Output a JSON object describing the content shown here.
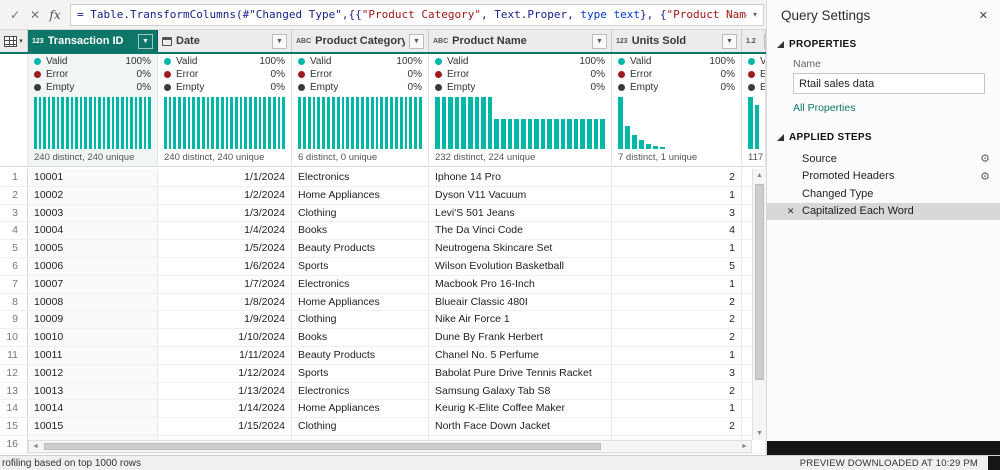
{
  "colors": {
    "accent_teal": "#0E7569",
    "histogram_teal": "#00B7A8",
    "valid_dot": "#00B7A8",
    "error_dot": "#9B1C1C",
    "empty_dot": "#3B3A39"
  },
  "icons": {
    "commit": "✓",
    "cancel": "✕",
    "fx": "fx",
    "chevron": "▾",
    "close": "✕",
    "delete": "✕",
    "gear": "⚙",
    "filter": "▼",
    "up": "▲",
    "down": "▼",
    "left": "◄",
    "right": "►",
    "corner_arrow": "▾",
    "type_whole": "123",
    "type_decimal": "1.2",
    "type_text": "ABC"
  },
  "formula_bar": {
    "segments": [
      {
        "text": "= Table.TransformColumns(#\"Changed Type\",{{",
        "color": "navy"
      },
      {
        "text": "\"Product Category\"",
        "color": "red"
      },
      {
        "text": ", Text.Proper, ",
        "color": "navy"
      },
      {
        "text": "type text",
        "color": "blue"
      },
      {
        "text": "}, {",
        "color": "navy"
      },
      {
        "text": "\"Product Name\",",
        "color": "red"
      }
    ]
  },
  "grid": {
    "quality_labels": {
      "valid": "Valid",
      "error": "Error",
      "empty": "Empty"
    },
    "columns": [
      {
        "name": "Transaction ID",
        "type": "whole-number",
        "selected": true,
        "quality": {
          "valid": "100%",
          "error": "0%",
          "empty": "0%"
        },
        "distinct": "240 distinct, 240 unique",
        "histogram": {
          "fill": true,
          "heights": [
            1,
            1,
            1,
            1,
            1,
            1,
            1,
            1,
            1,
            1,
            1,
            1,
            1,
            1,
            1,
            1,
            1,
            1,
            1,
            1,
            1,
            1,
            1,
            1,
            1,
            1
          ]
        }
      },
      {
        "name": "Date",
        "type": "date",
        "selected": false,
        "quality": {
          "valid": "100%",
          "error": "0%",
          "empty": "0%"
        },
        "distinct": "240 distinct, 240 unique",
        "histogram": {
          "fill": true,
          "heights": [
            1,
            1,
            1,
            1,
            1,
            1,
            1,
            1,
            1,
            1,
            1,
            1,
            1,
            1,
            1,
            1,
            1,
            1,
            1,
            1,
            1,
            1,
            1,
            1,
            1,
            1
          ]
        }
      },
      {
        "name": "Product Category",
        "type": "text",
        "selected": false,
        "quality": {
          "valid": "100%",
          "error": "0%",
          "empty": "0%"
        },
        "distinct": "6 distinct, 0 unique",
        "histogram": {
          "fill": true,
          "heights": [
            1,
            1,
            1,
            1,
            1,
            1,
            1,
            1,
            1,
            1,
            1,
            1,
            1,
            1,
            1,
            1,
            1,
            1,
            1,
            1,
            1,
            1,
            1,
            1,
            1,
            1
          ]
        }
      },
      {
        "name": "Product Name",
        "type": "text",
        "selected": false,
        "quality": {
          "valid": "100%",
          "error": "0%",
          "empty": "0%"
        },
        "distinct": "232 distinct, 224 unique",
        "histogram": {
          "fill": true,
          "heights": [
            1,
            1,
            1,
            1,
            1,
            1,
            1,
            1,
            1,
            0.58,
            0.58,
            0.58,
            0.58,
            0.58,
            0.58,
            0.58,
            0.58,
            0.58,
            0.58,
            0.58,
            0.58,
            0.58,
            0.58,
            0.58,
            0.58,
            0.58
          ]
        }
      },
      {
        "name": "Units Sold",
        "type": "whole-number",
        "selected": false,
        "quality": {
          "valid": "100%",
          "error": "0%",
          "empty": "0%"
        },
        "distinct": "7 distinct, 1 unique",
        "histogram": {
          "fill": false,
          "heights": [
            1,
            0.45,
            0.27,
            0.17,
            0.1,
            0.06,
            0.04
          ]
        }
      },
      {
        "name": "",
        "type": "decimal",
        "selected": false,
        "quality": {
          "valid": "",
          "error": "",
          "empty": ""
        },
        "distinct": "117",
        "histogram": {
          "fill": true,
          "heights": [
            1,
            0.85
          ]
        }
      }
    ],
    "rows": [
      {
        "n": "1",
        "cells": [
          "10001",
          "1/1/2024",
          "Electronics",
          "Iphone 14 Pro",
          "2",
          ""
        ]
      },
      {
        "n": "2",
        "cells": [
          "10002",
          "1/2/2024",
          "Home Appliances",
          "Dyson V11 Vacuum",
          "1",
          ""
        ]
      },
      {
        "n": "3",
        "cells": [
          "10003",
          "1/3/2024",
          "Clothing",
          "Levi'S 501 Jeans",
          "3",
          ""
        ]
      },
      {
        "n": "4",
        "cells": [
          "10004",
          "1/4/2024",
          "Books",
          "The Da Vinci Code",
          "4",
          ""
        ]
      },
      {
        "n": "5",
        "cells": [
          "10005",
          "1/5/2024",
          "Beauty Products",
          "Neutrogena Skincare Set",
          "1",
          ""
        ]
      },
      {
        "n": "6",
        "cells": [
          "10006",
          "1/6/2024",
          "Sports",
          "Wilson Evolution Basketball",
          "5",
          ""
        ]
      },
      {
        "n": "7",
        "cells": [
          "10007",
          "1/7/2024",
          "Electronics",
          "Macbook Pro 16-Inch",
          "1",
          ""
        ]
      },
      {
        "n": "8",
        "cells": [
          "10008",
          "1/8/2024",
          "Home Appliances",
          "Blueair Classic 480I",
          "2",
          ""
        ]
      },
      {
        "n": "9",
        "cells": [
          "10009",
          "1/9/2024",
          "Clothing",
          "Nike Air Force 1",
          "2",
          ""
        ]
      },
      {
        "n": "10",
        "cells": [
          "10010",
          "1/10/2024",
          "Books",
          "Dune By Frank Herbert",
          "2",
          ""
        ]
      },
      {
        "n": "11",
        "cells": [
          "10011",
          "1/11/2024",
          "Beauty Products",
          "Chanel No. 5 Perfume",
          "1",
          ""
        ]
      },
      {
        "n": "12",
        "cells": [
          "10012",
          "1/12/2024",
          "Sports",
          "Babolat Pure Drive Tennis Racket",
          "3",
          ""
        ]
      },
      {
        "n": "13",
        "cells": [
          "10013",
          "1/13/2024",
          "Electronics",
          "Samsung Galaxy Tab S8",
          "2",
          ""
        ]
      },
      {
        "n": "14",
        "cells": [
          "10014",
          "1/14/2024",
          "Home Appliances",
          "Keurig K-Elite Coffee Maker",
          "1",
          ""
        ]
      },
      {
        "n": "15",
        "cells": [
          "10015",
          "1/15/2024",
          "Clothing",
          "North Face Down Jacket",
          "2",
          ""
        ]
      },
      {
        "n": "16",
        "cells": [
          "",
          "",
          "",
          "",
          "",
          ""
        ]
      }
    ]
  },
  "query_settings": {
    "title": "Query Settings",
    "properties_header": "PROPERTIES",
    "name_label": "Name",
    "name_value": "Rtail sales data",
    "all_properties": "All Properties",
    "applied_steps_header": "APPLIED STEPS",
    "steps": [
      {
        "label": "Source",
        "gear": true,
        "selected": false,
        "deletable": false
      },
      {
        "label": "Promoted Headers",
        "gear": true,
        "selected": false,
        "deletable": false
      },
      {
        "label": "Changed Type",
        "gear": false,
        "selected": false,
        "deletable": false
      },
      {
        "label": "Capitalized Each Word",
        "gear": false,
        "selected": true,
        "deletable": true
      }
    ]
  },
  "status_bar": {
    "left": "rofiling based on top 1000 rows",
    "right": "PREVIEW DOWNLOADED AT 10:29 PM"
  }
}
